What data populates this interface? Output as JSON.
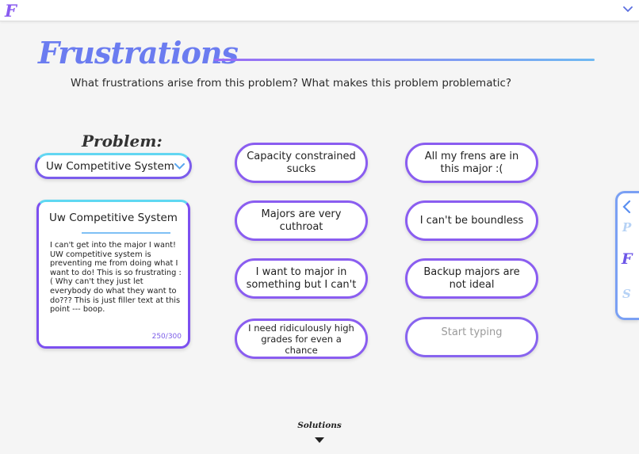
{
  "app": {
    "logo_letter": "F"
  },
  "header": {
    "title": "Frustrations",
    "subtitle": "What frustrations arise from this problem? What makes this problem problematic?"
  },
  "problem": {
    "label": "Problem:",
    "selected": "Uw Competitive System",
    "card": {
      "title": "Uw Competitive System",
      "body": "I can't get into the major I want! UW competitive system is preventing me from doing what I want to do! This is so frustrating :( Why can't they just let everybody do what they want to do??? This is just filler text at this point --- boop.",
      "count": "250/300"
    }
  },
  "frustrations": {
    "col1": [
      "Capacity constrained sucks",
      "Majors are very cuthroat",
      "I want to major in something but I can't",
      "I need ridiculously high grades for even a chance"
    ],
    "col2": [
      "All my frens are in this major :(",
      "I can't be boundless",
      "Backup majors are not ideal"
    ],
    "new_placeholder": "Start typing"
  },
  "side_nav": {
    "items": [
      {
        "letter": "P",
        "state": "inactive"
      },
      {
        "letter": "F",
        "state": "active"
      },
      {
        "letter": "S",
        "state": "inactive"
      }
    ]
  },
  "footer": {
    "next_label": "Solutions"
  },
  "colors": {
    "accent_purple": "#8a5df0",
    "accent_blue": "#6fb9f2",
    "accent_cyan": "#5ed8f2"
  }
}
